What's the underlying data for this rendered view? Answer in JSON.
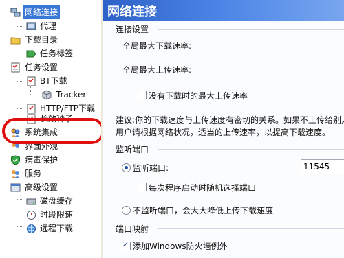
{
  "sidebar": {
    "items": [
      {
        "label": "网络连接",
        "icon": "network-icon"
      },
      {
        "label": "代理",
        "icon": "proxy-icon"
      },
      {
        "label": "下载目录",
        "icon": "folder-icon"
      },
      {
        "label": "任务标签",
        "icon": "tag-icon"
      },
      {
        "label": "任务设置",
        "icon": "task-icon"
      },
      {
        "label": "BT下载",
        "icon": "bt-icon"
      },
      {
        "label": "Tracker",
        "icon": "tracker-icon"
      },
      {
        "label": "HTTP/FTP下载",
        "icon": "http-icon"
      },
      {
        "label": "长效种子",
        "icon": "seed-icon"
      },
      {
        "label": "系统集成",
        "icon": "integration-icon"
      },
      {
        "label": "界面外观",
        "icon": "appearance-icon"
      },
      {
        "label": "病毒保护",
        "icon": "shield-icon"
      },
      {
        "label": "服务",
        "icon": "service-icon"
      },
      {
        "label": "高级设置",
        "icon": "advanced-icon"
      },
      {
        "label": "磁盘缓存",
        "icon": "disk-icon"
      },
      {
        "label": "时段限速",
        "icon": "clock-icon"
      },
      {
        "label": "远程下载",
        "icon": "remote-icon"
      }
    ]
  },
  "header": {
    "title": "网络连接"
  },
  "connection": {
    "group_label": "连接设置",
    "max_download_label": "全局最大下载速率:",
    "max_upload_label": "全局最大上传速率:",
    "no_task_upload_checkbox": "没有下载时的最大上传速率",
    "advice": "建议:你的下载速度与上传速度有密切的关系。如果不上传给别人",
    "advice_line2": "用户请根据网络状况，适当的上传速率，以提高下载速度。"
  },
  "listen": {
    "group_label": "监听端口",
    "listen_radio": "监听端口:",
    "port_value": "11545",
    "random_checkbox": "每次程序启动时随机选择端口",
    "no_listen_radio": "不监听端口，会大大降低上传下载速度"
  },
  "mapping": {
    "group_label": "端口映射",
    "firewall_checkbox": "添加Windows防火墙例外"
  },
  "colors": {
    "selection": "#3a78d6",
    "header_gradient_start": "#2e61c9",
    "highlight_ring": "#e01010"
  }
}
